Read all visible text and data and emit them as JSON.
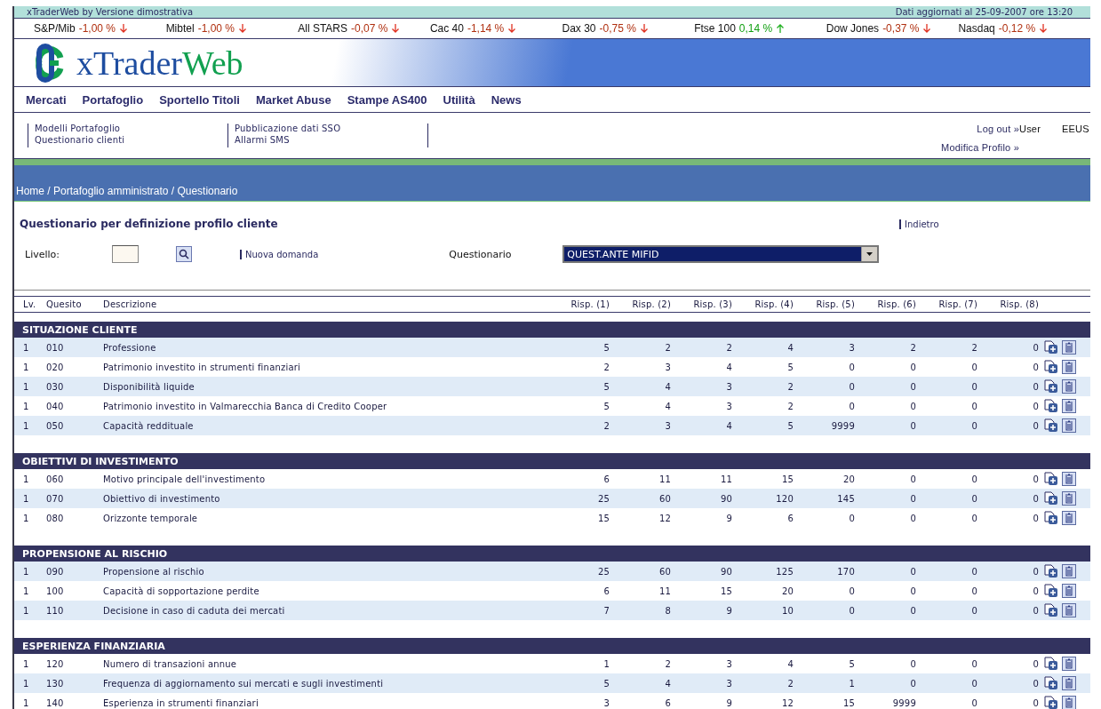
{
  "topbar": {
    "title": "xTraderWeb by Versione dimostrativa",
    "updated": "Dati aggiornati al 25-09-2007 ore 13:20"
  },
  "ticker": [
    {
      "name": "S&P/Mib",
      "value": "-1,00 %",
      "rising": false
    },
    {
      "name": "Mibtel",
      "value": "-1,00 %",
      "rising": false
    },
    {
      "name": "All STARS",
      "value": "-0,07 %",
      "rising": false
    },
    {
      "name": "Cac 40",
      "value": "-1,14 %",
      "rising": false
    },
    {
      "name": "Dax 30",
      "value": "-0,75 %",
      "rising": false
    },
    {
      "name": "Ftse 100",
      "value": "0,14 %",
      "rising": true
    },
    {
      "name": "Dow Jones",
      "value": "-0,37 %",
      "rising": false
    },
    {
      "name": "Nasdaq",
      "value": "-0,12 %",
      "rising": false
    }
  ],
  "logo": {
    "text": "xTrader",
    "accent": "Web"
  },
  "nav": [
    "Mercati",
    "Portafoglio",
    "Sportello Titoli",
    "Market Abuse",
    "Stampe AS400",
    "Utilità",
    "News"
  ],
  "submenu": {
    "columns": [
      [
        "Modelli Portafoglio",
        "Questionario clienti"
      ],
      [
        "Pubblicazione dati SSO",
        "Allarmi SMS"
      ]
    ],
    "account": {
      "logout": "Log out »",
      "user_label": "User",
      "user": "EEUS",
      "profile": "Modifica Profilo »"
    }
  },
  "breadcrumb": "Home / Portafoglio amministrato / Questionario",
  "page_title": "Questionario per definizione profilo cliente",
  "back_link": "Indietro",
  "form": {
    "level_label": "Livello:",
    "new_question": "Nuova domanda",
    "questionnaire_label": "Questionario",
    "questionnaire_value": "QUEST.ANTE MIFID"
  },
  "table": {
    "columns": [
      "Lv.",
      "Quesito",
      "Descrizione",
      "Risp. (1)",
      "Risp. (2)",
      "Risp. (3)",
      "Risp. (4)",
      "Risp. (5)",
      "Risp. (6)",
      "Risp. (7)",
      "Risp. (8)"
    ],
    "sections": [
      {
        "title": "SITUAZIONE CLIENTE",
        "rows": [
          {
            "lv": "1",
            "code": "010",
            "description": "Professione",
            "answers": [
              "5",
              "2",
              "2",
              "4",
              "3",
              "2",
              "2",
              "0"
            ]
          },
          {
            "lv": "1",
            "code": "020",
            "description": "Patrimonio investito in strumenti finanziari",
            "answers": [
              "2",
              "3",
              "4",
              "5",
              "0",
              "0",
              "0",
              "0"
            ]
          },
          {
            "lv": "1",
            "code": "030",
            "description": "Disponibilità liquide",
            "answers": [
              "5",
              "4",
              "3",
              "2",
              "0",
              "0",
              "0",
              "0"
            ]
          },
          {
            "lv": "1",
            "code": "040",
            "description": "Patrimonio investito in Valmarecchia Banca di Credito Cooper",
            "answers": [
              "5",
              "4",
              "3",
              "2",
              "0",
              "0",
              "0",
              "0"
            ]
          },
          {
            "lv": "1",
            "code": "050",
            "description": "Capacità reddituale",
            "answers": [
              "2",
              "3",
              "4",
              "5",
              "9999",
              "0",
              "0",
              "0"
            ]
          }
        ]
      },
      {
        "title": "OBIETTIVI DI INVESTIMENTO",
        "rows": [
          {
            "lv": "1",
            "code": "060",
            "description": "Motivo principale dell'investimento",
            "answers": [
              "6",
              "11",
              "11",
              "15",
              "20",
              "0",
              "0",
              "0"
            ]
          },
          {
            "lv": "1",
            "code": "070",
            "description": "Obiettivo di investimento",
            "answers": [
              "25",
              "60",
              "90",
              "120",
              "145",
              "0",
              "0",
              "0"
            ]
          },
          {
            "lv": "1",
            "code": "080",
            "description": "Orizzonte temporale",
            "answers": [
              "15",
              "12",
              "9",
              "6",
              "0",
              "0",
              "0",
              "0"
            ]
          }
        ]
      },
      {
        "title": "PROPENSIONE AL RISCHIO",
        "rows": [
          {
            "lv": "1",
            "code": "090",
            "description": "Propensione al rischio",
            "answers": [
              "25",
              "60",
              "90",
              "125",
              "170",
              "0",
              "0",
              "0"
            ]
          },
          {
            "lv": "1",
            "code": "100",
            "description": "Capacità di sopportazione perdite",
            "answers": [
              "6",
              "11",
              "15",
              "20",
              "0",
              "0",
              "0",
              "0"
            ]
          },
          {
            "lv": "1",
            "code": "110",
            "description": "Decisione in caso di caduta dei mercati",
            "answers": [
              "7",
              "8",
              "9",
              "10",
              "0",
              "0",
              "0",
              "0"
            ]
          }
        ]
      },
      {
        "title": "ESPERIENZA FINANZIARIA",
        "rows": [
          {
            "lv": "1",
            "code": "120",
            "description": "Numero di transazioni annue",
            "answers": [
              "1",
              "2",
              "3",
              "4",
              "5",
              "0",
              "0",
              "0"
            ]
          },
          {
            "lv": "1",
            "code": "130",
            "description": "Frequenza di aggiornamento sui mercati e sugli investimenti",
            "answers": [
              "5",
              "4",
              "3",
              "2",
              "1",
              "0",
              "0",
              "0"
            ]
          },
          {
            "lv": "1",
            "code": "140",
            "description": "Esperienza in strumenti finanziari",
            "answers": [
              "3",
              "6",
              "9",
              "12",
              "15",
              "9999",
              "0",
              "0"
            ]
          }
        ]
      }
    ]
  }
}
